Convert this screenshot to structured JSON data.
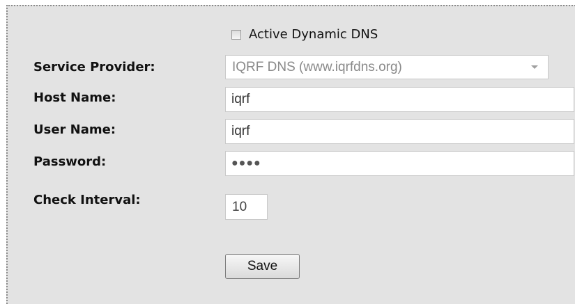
{
  "form": {
    "active_ddns": {
      "label": "Active Dynamic DNS",
      "checked": false
    },
    "service_provider": {
      "label": "Service Provider:",
      "value": "IQRF DNS (www.iqrfdns.org)"
    },
    "host_name": {
      "label": "Host Name:",
      "value": "iqrf"
    },
    "user_name": {
      "label": "User Name:",
      "value": "iqrf"
    },
    "password": {
      "label": "Password:",
      "masked_value": "●●●●"
    },
    "check_interval": {
      "label": "Check Interval:",
      "value": "10"
    },
    "save_label": "Save"
  }
}
